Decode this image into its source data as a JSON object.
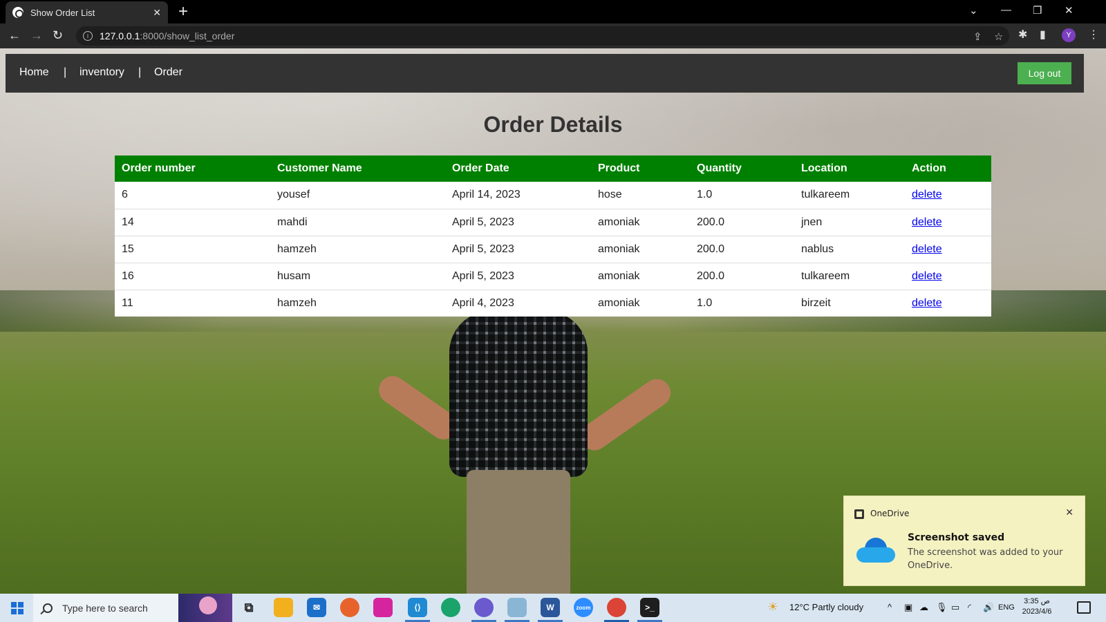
{
  "browser": {
    "tab_title": "Show Order List",
    "tab_close": "✕",
    "new_tab": "+",
    "url_host": "127.0.0.1",
    "url_path": ":8000/show_list_order",
    "profile_initial": "Y"
  },
  "nav": {
    "home": "Home",
    "sep": "|",
    "inventory": "inventory",
    "order": "Order",
    "logout": "Log out"
  },
  "page": {
    "title": "Order Details"
  },
  "table": {
    "headers": [
      "Order number",
      "Customer Name",
      "Order Date",
      "Product",
      "Quantity",
      "Location",
      "Action"
    ],
    "rows": [
      [
        "6",
        "yousef",
        "April 14, 2023",
        "hose",
        "1.0",
        "tulkareem",
        "delete"
      ],
      [
        "14",
        "mahdi",
        "April 5, 2023",
        "amoniak",
        "200.0",
        "jnen",
        "delete"
      ],
      [
        "15",
        "hamzeh",
        "April 5, 2023",
        "amoniak",
        "200.0",
        "nablus",
        "delete"
      ],
      [
        "16",
        "husam",
        "April 5, 2023",
        "amoniak",
        "200.0",
        "tulkareem",
        "delete"
      ],
      [
        "11",
        "hamzeh",
        "April 4, 2023",
        "amoniak",
        "1.0",
        "birzeit",
        "delete"
      ]
    ]
  },
  "toast": {
    "app": "OneDrive",
    "close": "✕",
    "heading": "Screenshot saved",
    "body": "The screenshot was added to your OneDrive."
  },
  "taskbar": {
    "search_placeholder": "Type here to search",
    "weather": "12°C  Partly cloudy",
    "lang": "ENG",
    "time": "3:35 ص",
    "date": "2023/4/6"
  },
  "colors": {
    "nav_bg": "#333333",
    "table_header": "#008000",
    "logout_bg": "#4caf50",
    "link": "#0000ee"
  }
}
